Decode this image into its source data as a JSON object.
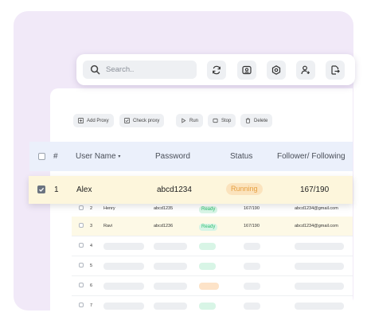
{
  "search": {
    "placeholder": "Search.."
  },
  "toolbar_icons": [
    "refresh-icon",
    "screenshot-icon",
    "settings-icon",
    "add-user-icon",
    "export-icon"
  ],
  "actions": {
    "add_proxy": "Add Proxy",
    "check_proxy": "Check proxy",
    "run": "Run",
    "stop": "Stop",
    "delete": "Delete"
  },
  "table": {
    "headers": {
      "index": "#",
      "username": "User Name",
      "password": "Password",
      "status": "Status",
      "followers": "Follower/ Following"
    },
    "selected_row": {
      "index": "1",
      "username": "Alex",
      "password": "abcd1234",
      "status": "Running",
      "followers": "167/190"
    },
    "rows": [
      {
        "index": "2",
        "username": "Henry",
        "password": "abcd1235",
        "status": "Ready",
        "followers": "167/190",
        "email": "abcd1234@gmail.com"
      },
      {
        "index": "3",
        "username": "Ravi",
        "password": "abcd1236",
        "status": "Ready",
        "followers": "167/190",
        "email": "abcd1234@gmail.com"
      }
    ],
    "placeholder_row_indices": [
      "4",
      "5",
      "6",
      "7"
    ]
  },
  "colors": {
    "background": "#f1e9f8",
    "header": "#ebf0fb",
    "running_badge": "#fbe3bd",
    "ready_badge": "#d8f5e6"
  }
}
